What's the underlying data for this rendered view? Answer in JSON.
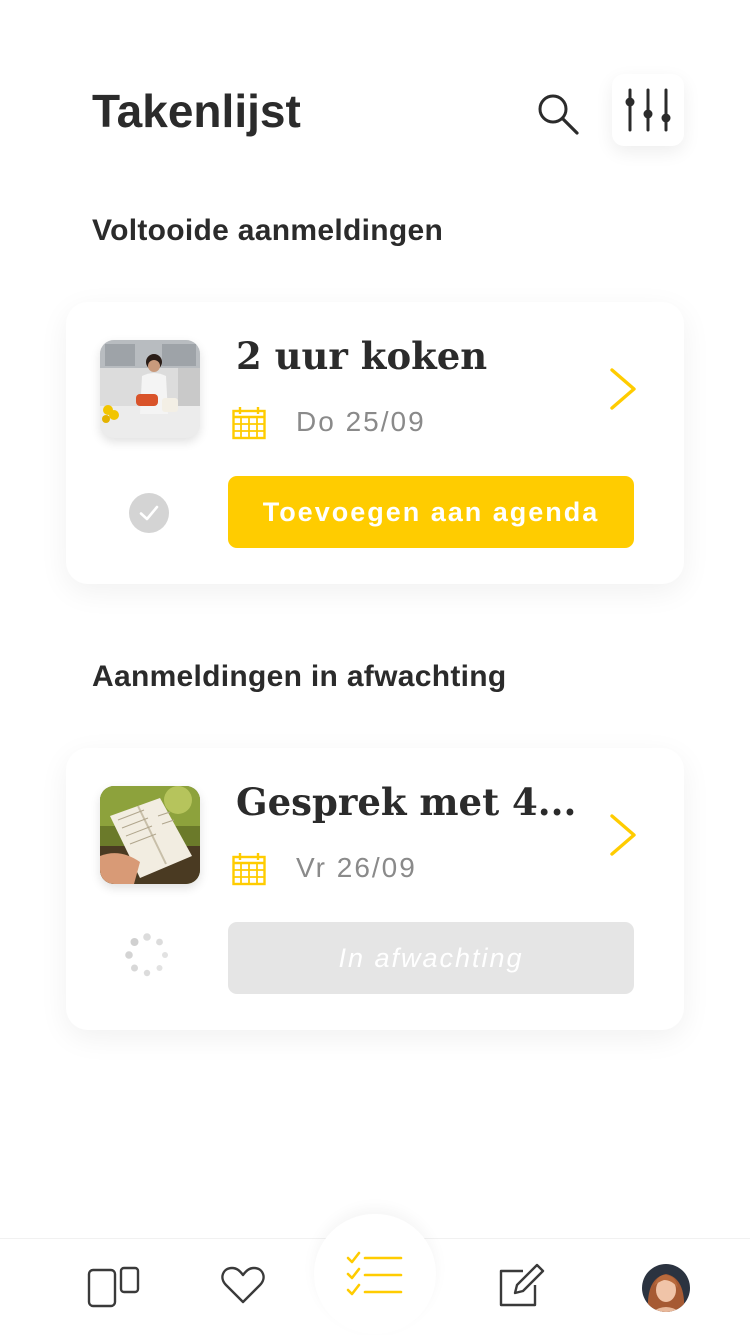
{
  "header": {
    "title": "Takenlijst",
    "search_icon": "search-icon",
    "filter_icon": "sliders-icon"
  },
  "sections": [
    {
      "title": "Voltooide aanmeldingen",
      "card": {
        "title": "2 uur koken",
        "date": "Do 25/09",
        "thumbnail": "cooking-photo",
        "status": "completed",
        "status_icon": "check-circle-icon",
        "button_label": "Toevoegen aan agenda"
      }
    },
    {
      "title": "Aanmeldingen in afwachting",
      "card": {
        "title": "Gesprek met 4...",
        "date": "Vr 26/09",
        "thumbnail": "book-photo",
        "status": "pending",
        "status_icon": "loading-spinner-icon",
        "button_label": "In afwachting"
      }
    }
  ],
  "bottom_nav": {
    "items": [
      {
        "icon": "cards-icon",
        "active": false
      },
      {
        "icon": "heart-icon",
        "active": false
      },
      {
        "icon": "checklist-icon",
        "active": true
      },
      {
        "icon": "edit-icon",
        "active": false
      },
      {
        "icon": "profile-avatar",
        "active": false
      }
    ]
  },
  "colors": {
    "accent": "#ffcc00",
    "text": "#2b2b2b",
    "muted": "#8a8a8a",
    "disabled": "#e5e5e5",
    "check_circle": "#d4d4d4"
  }
}
